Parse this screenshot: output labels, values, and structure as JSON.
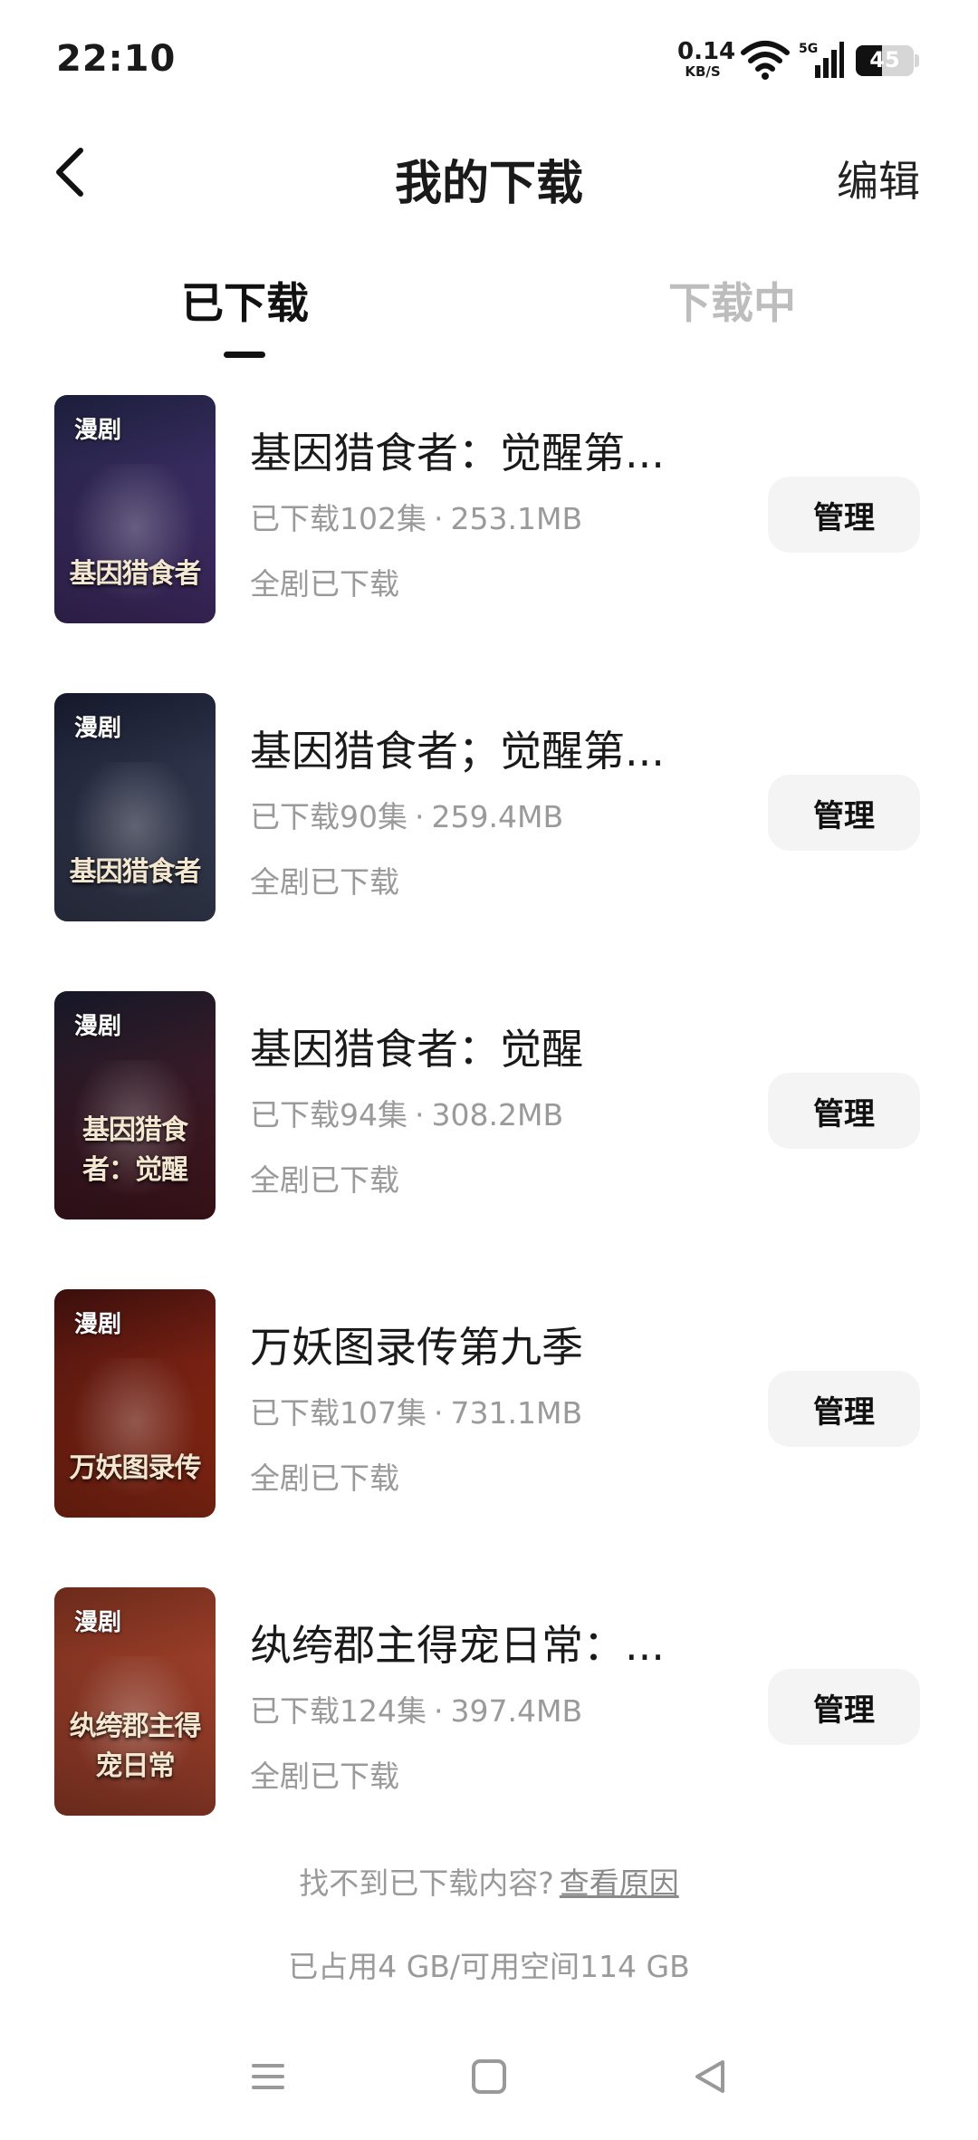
{
  "status_bar": {
    "time": "22:10",
    "net_speed_value": "0.14",
    "net_speed_unit": "KB/S",
    "signal_label": "5G",
    "battery_level": "45",
    "battery_fraction": 0.45
  },
  "header": {
    "title": "我的下载",
    "edit_label": "编辑"
  },
  "tabs": [
    {
      "label": "已下载",
      "active": true
    },
    {
      "label": "下载中",
      "active": false
    }
  ],
  "items": [
    {
      "badge": "漫剧",
      "cover_title": "基因猎食者",
      "title": "基因猎食者：觉醒第...",
      "episodes": "已下载102集",
      "size": "253.1MB",
      "status": "全剧已下载",
      "manage_label": "管理",
      "cover_colors": [
        "#1b1e3a",
        "#5a3c8c"
      ]
    },
    {
      "badge": "漫剧",
      "cover_title": "基因猎食者",
      "title": "基因猎食者；觉醒第...",
      "episodes": "已下载90集",
      "size": "259.4MB",
      "status": "全剧已下载",
      "manage_label": "管理",
      "cover_colors": [
        "#15182a",
        "#4b5370"
      ]
    },
    {
      "badge": "漫剧",
      "cover_title": "基因猎食者：觉醒",
      "title": "基因猎食者：觉醒",
      "episodes": "已下载94集",
      "size": "308.2MB",
      "status": "全剧已下载",
      "manage_label": "管理",
      "cover_colors": [
        "#151827",
        "#5e1d28"
      ]
    },
    {
      "badge": "漫剧",
      "cover_title": "万妖图录传",
      "title": "万妖图录传第九季",
      "episodes": "已下载107集",
      "size": "731.1MB",
      "status": "全剧已下载",
      "manage_label": "管理",
      "cover_colors": [
        "#3a0e0c",
        "#c2381b"
      ]
    },
    {
      "badge": "漫剧",
      "cover_title": "纨绔郡主得宠日常",
      "title": "纨绔郡主得宠日常：...",
      "episodes": "已下载124集",
      "size": "397.4MB",
      "status": "全剧已下载",
      "manage_label": "管理",
      "cover_colors": [
        "#6b2a1a",
        "#d2553a"
      ]
    }
  ],
  "footer": {
    "hint_text": "找不到已下载内容?",
    "hint_link": "查看原因",
    "storage_text": "已占用4 GB/可用空间114 GB"
  },
  "nav_bar": {
    "menu_icon": "menu-lines-icon",
    "home_icon": "square-home-icon",
    "back_icon": "triangle-back-icon"
  }
}
